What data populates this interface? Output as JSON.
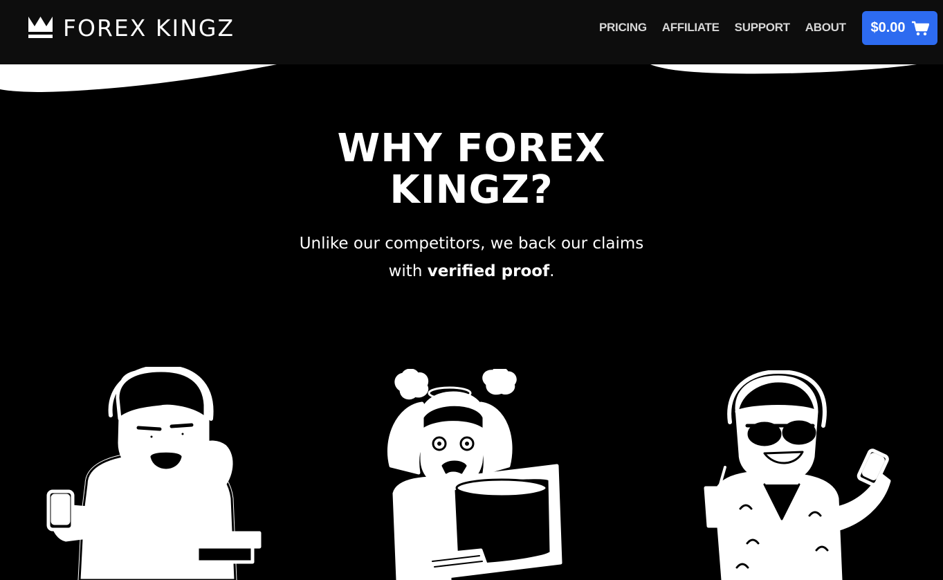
{
  "brand": {
    "name": "FOREX KINGZ",
    "logo_icon": "crown-icon"
  },
  "nav": {
    "links": [
      {
        "label": "PRICING"
      },
      {
        "label": "AFFILIATE"
      },
      {
        "label": "SUPPORT"
      },
      {
        "label": "ABOUT"
      }
    ]
  },
  "cart": {
    "total": "$0.00",
    "icon": "cart-icon",
    "color": "#2d6bf0"
  },
  "hero": {
    "title_line1": "WHY FOREX",
    "title_line2": "KINGZ?",
    "subtitle_line1": "Unlike our competitors, we back our claims",
    "subtitle_prefix": "with ",
    "subtitle_bold": "verified proof",
    "subtitle_suffix": "."
  },
  "illustrations": [
    {
      "name": "bored-trader-illustration"
    },
    {
      "name": "stressed-trader-illustration"
    },
    {
      "name": "rich-trader-illustration"
    }
  ],
  "colors": {
    "background": "#000000",
    "navbar": "#0d0d0d",
    "accent": "#2d6bf0",
    "text": "#ffffff"
  }
}
